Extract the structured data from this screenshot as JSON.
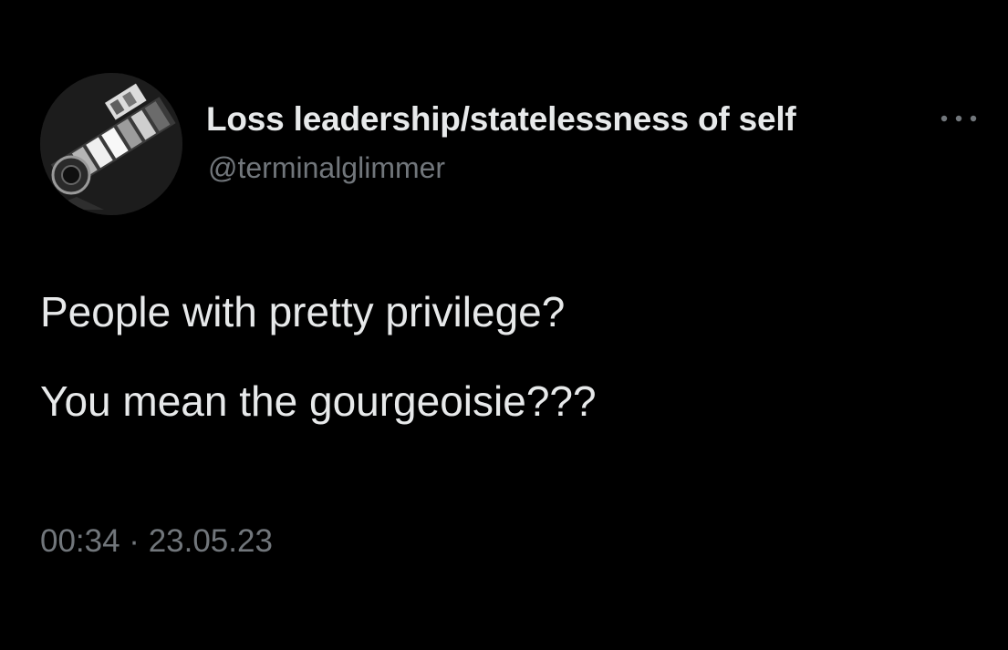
{
  "tweet": {
    "author": {
      "display_name": "Loss leadership/statelessness of self",
      "handle": "@terminalglimmer",
      "avatar_icon": "avatar-image"
    },
    "more_icon": "more-options-icon",
    "text_lines": [
      "People with pretty privilege?",
      "You mean the gourgeoisie???"
    ],
    "timestamp": "00:34 · 23.05.23"
  },
  "colors": {
    "background": "#000000",
    "primary_text": "#e7e9ea",
    "secondary_text": "#71767b"
  }
}
